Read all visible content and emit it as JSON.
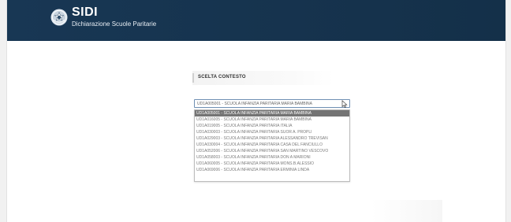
{
  "header": {
    "title": "SIDI",
    "subtitle": "Dichiarazione Scuole Paritarie"
  },
  "context": {
    "title": "SCELTA CONTESTO"
  },
  "select": {
    "value": "UD1A005001 - SCUOLA INFANZIA PARITARIA MARIA BAMBINA"
  },
  "dropdown": {
    "options": [
      {
        "label": "UD1A005001 - SCUOLA INFANZIA PARITARIA MARIA BAMBINA",
        "selected": true
      },
      {
        "label": "UD1A016005 - SCUOLA INFANZIA PARITARIA MARIA BAMBINA",
        "selected": false
      },
      {
        "label": "UD1A019005 - SCUOLA INFANZIA PARITARIA ITALIA",
        "selected": false
      },
      {
        "label": "UD1A030003 - SCUOLA INFANZIA PARITARIA SUOR A. PROPLI",
        "selected": false
      },
      {
        "label": "UD1A029003 - SCUOLA INFANZIA PARITARIA ALESSANDRO TREVISAN",
        "selected": false
      },
      {
        "label": "UD1A030004 - SCUOLA INFANZIA PARITARIA CASA DEL FANCIULLO",
        "selected": false
      },
      {
        "label": "UD1A052006 - SCUOLA INFANZIA PARITARIA SAN MARTINO VESCOVO",
        "selected": false
      },
      {
        "label": "UD1A058003 - SCUOLA INFANZIA PARITARIA DON A MARIONI",
        "selected": false
      },
      {
        "label": "UD1A060005 - SCUOLA INFANZIA PARITARIA MONS.B.ALESSIO",
        "selected": false
      },
      {
        "label": "UD1A069006 - SCUOLA INFANZIA PARITARIA ERMINIA LINDA",
        "selected": false
      }
    ]
  },
  "colors": {
    "header": "#183754",
    "selected_option": "#747474",
    "select_border": "#6f8fb3"
  },
  "icons": {
    "emblem": "italian-emblem-icon",
    "cursor": "mouse-cursor-icon"
  }
}
